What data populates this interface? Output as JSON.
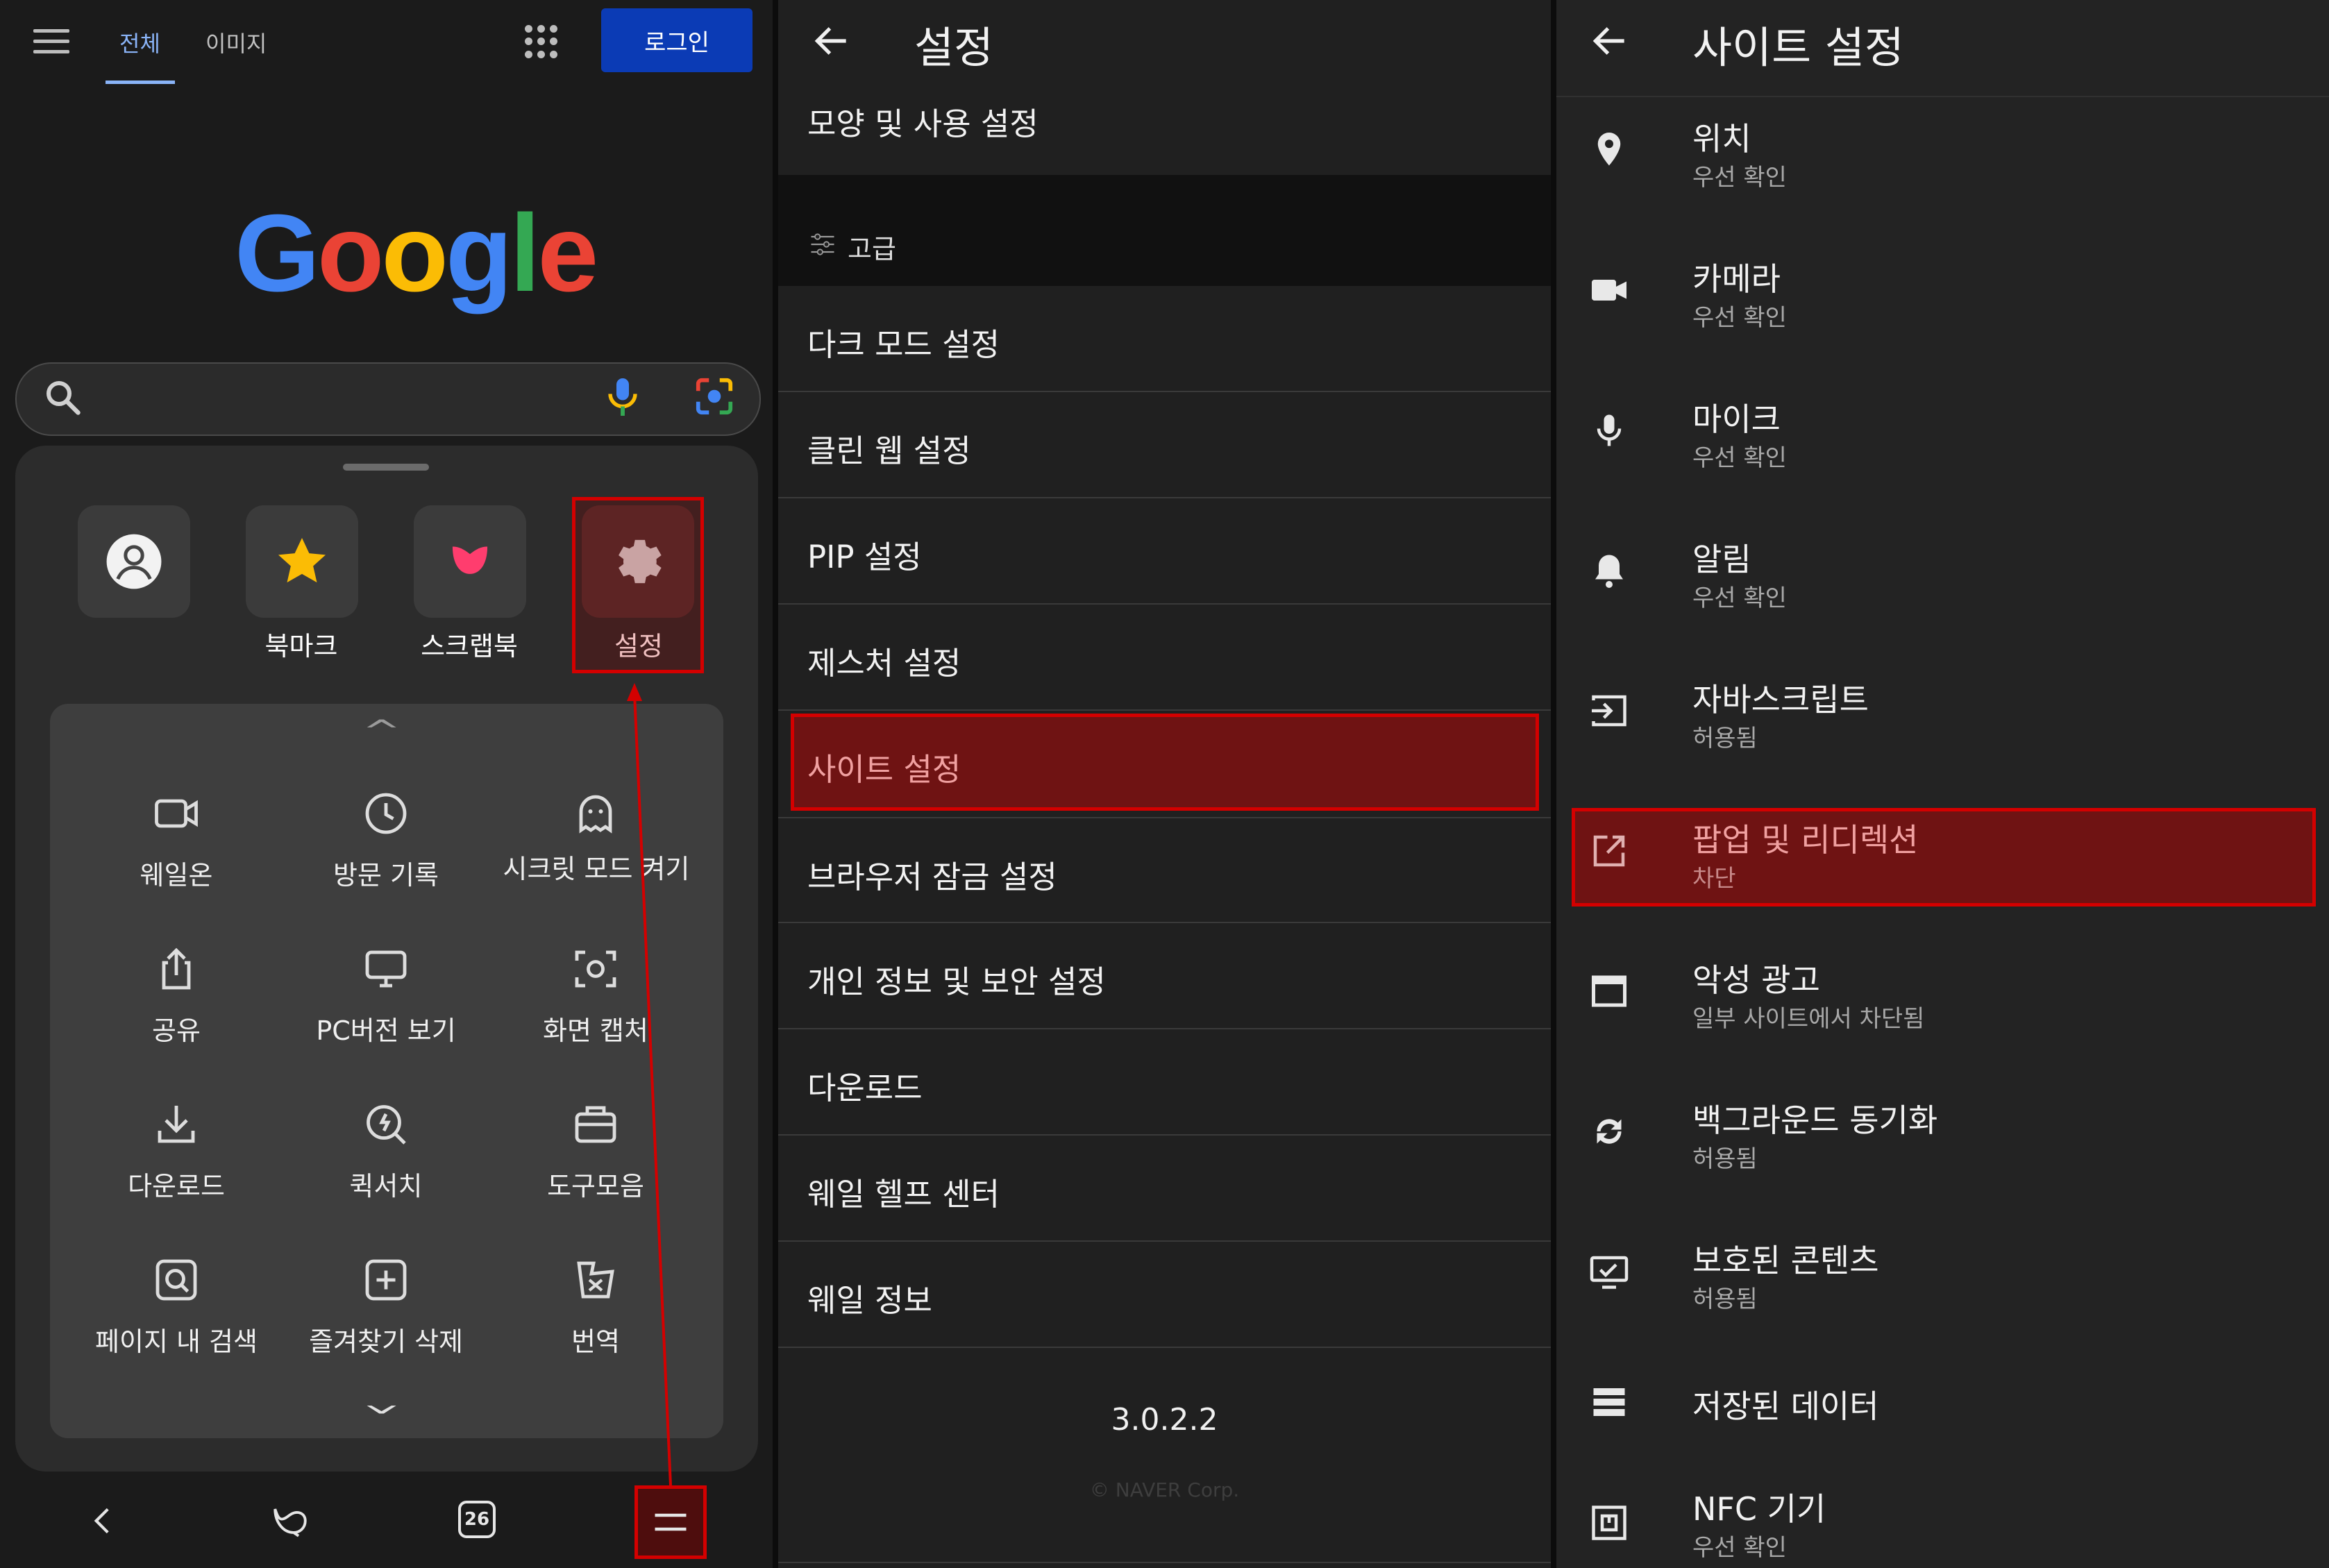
{
  "panel1": {
    "tabs": {
      "all": "전체",
      "images": "이미지"
    },
    "login": "로그인",
    "google_logo": "Google",
    "quick_items": [
      "",
      "북마크",
      "스크랩북",
      "설정"
    ],
    "grid_items": [
      "웨일온",
      "방문 기록",
      "시크릿 모드 켜기",
      "공유",
      "PC버전 보기",
      "화면 캡처",
      "다운로드",
      "퀵서치",
      "도구모음",
      "페이지 내 검색",
      "즐겨찾기 삭제",
      "번역"
    ],
    "tab_count": "26",
    "highlight_color": "#d40000"
  },
  "panel2": {
    "title": "설정",
    "top_row": "모양 및 사용 설정",
    "section": "고급",
    "items": [
      "다크 모드 설정",
      "클린 웹 설정",
      "PIP 설정",
      "제스처 설정",
      "사이트 설정",
      "브라우저 잠금 설정",
      "개인 정보 및 보안 설정",
      "다운로드",
      "웨일 헬프 센터",
      "웨일 정보"
    ],
    "version": "3.0.2.2",
    "copyright": "© NAVER Corp."
  },
  "panel3": {
    "title": "사이트 설정",
    "items": [
      {
        "title": "위치",
        "sub": "우선 확인",
        "icon": "location-icon"
      },
      {
        "title": "카메라",
        "sub": "우선 확인",
        "icon": "camera-icon"
      },
      {
        "title": "마이크",
        "sub": "우선 확인",
        "icon": "microphone-icon"
      },
      {
        "title": "알림",
        "sub": "우선 확인",
        "icon": "bell-icon"
      },
      {
        "title": "자바스크립트",
        "sub": "허용됨",
        "icon": "javascript-icon"
      },
      {
        "title": "팝업 및 리디렉션",
        "sub": "차단",
        "icon": "popup-icon"
      },
      {
        "title": "악성 광고",
        "sub": "일부 사이트에서 차단됨",
        "icon": "ads-icon"
      },
      {
        "title": "백그라운드 동기화",
        "sub": "허용됨",
        "icon": "sync-icon"
      },
      {
        "title": "보호된 콘텐츠",
        "sub": "허용됨",
        "icon": "protected-content-icon"
      },
      {
        "title": "저장된 데이터",
        "sub": "",
        "icon": "storage-icon"
      },
      {
        "title": "NFC 기기",
        "sub": "우선 확인",
        "icon": "nfc-icon"
      }
    ]
  }
}
